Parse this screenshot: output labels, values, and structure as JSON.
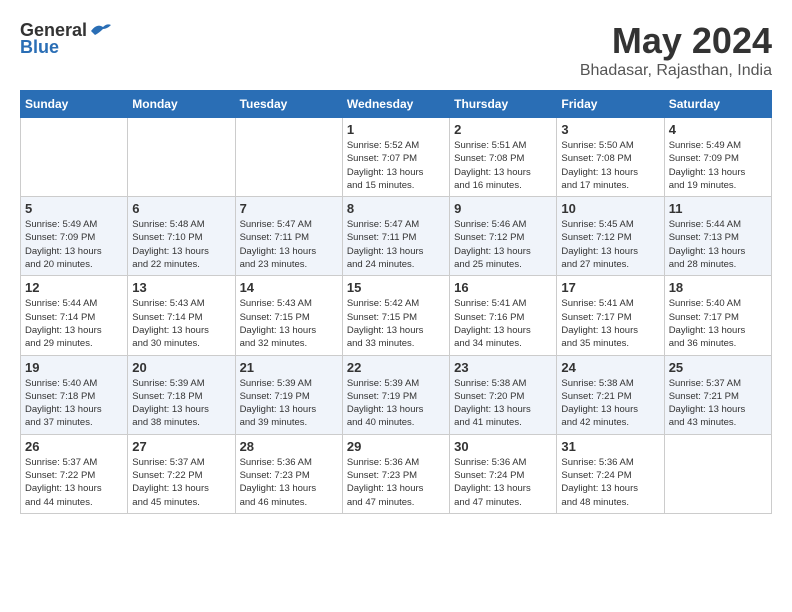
{
  "logo": {
    "general": "General",
    "blue": "Blue"
  },
  "title": "May 2024",
  "location": "Bhadasar, Rajasthan, India",
  "days_header": [
    "Sunday",
    "Monday",
    "Tuesday",
    "Wednesday",
    "Thursday",
    "Friday",
    "Saturday"
  ],
  "weeks": [
    [
      {
        "day": "",
        "info": ""
      },
      {
        "day": "",
        "info": ""
      },
      {
        "day": "",
        "info": ""
      },
      {
        "day": "1",
        "info": "Sunrise: 5:52 AM\nSunset: 7:07 PM\nDaylight: 13 hours\nand 15 minutes."
      },
      {
        "day": "2",
        "info": "Sunrise: 5:51 AM\nSunset: 7:08 PM\nDaylight: 13 hours\nand 16 minutes."
      },
      {
        "day": "3",
        "info": "Sunrise: 5:50 AM\nSunset: 7:08 PM\nDaylight: 13 hours\nand 17 minutes."
      },
      {
        "day": "4",
        "info": "Sunrise: 5:49 AM\nSunset: 7:09 PM\nDaylight: 13 hours\nand 19 minutes."
      }
    ],
    [
      {
        "day": "5",
        "info": "Sunrise: 5:49 AM\nSunset: 7:09 PM\nDaylight: 13 hours\nand 20 minutes."
      },
      {
        "day": "6",
        "info": "Sunrise: 5:48 AM\nSunset: 7:10 PM\nDaylight: 13 hours\nand 22 minutes."
      },
      {
        "day": "7",
        "info": "Sunrise: 5:47 AM\nSunset: 7:11 PM\nDaylight: 13 hours\nand 23 minutes."
      },
      {
        "day": "8",
        "info": "Sunrise: 5:47 AM\nSunset: 7:11 PM\nDaylight: 13 hours\nand 24 minutes."
      },
      {
        "day": "9",
        "info": "Sunrise: 5:46 AM\nSunset: 7:12 PM\nDaylight: 13 hours\nand 25 minutes."
      },
      {
        "day": "10",
        "info": "Sunrise: 5:45 AM\nSunset: 7:12 PM\nDaylight: 13 hours\nand 27 minutes."
      },
      {
        "day": "11",
        "info": "Sunrise: 5:44 AM\nSunset: 7:13 PM\nDaylight: 13 hours\nand 28 minutes."
      }
    ],
    [
      {
        "day": "12",
        "info": "Sunrise: 5:44 AM\nSunset: 7:14 PM\nDaylight: 13 hours\nand 29 minutes."
      },
      {
        "day": "13",
        "info": "Sunrise: 5:43 AM\nSunset: 7:14 PM\nDaylight: 13 hours\nand 30 minutes."
      },
      {
        "day": "14",
        "info": "Sunrise: 5:43 AM\nSunset: 7:15 PM\nDaylight: 13 hours\nand 32 minutes."
      },
      {
        "day": "15",
        "info": "Sunrise: 5:42 AM\nSunset: 7:15 PM\nDaylight: 13 hours\nand 33 minutes."
      },
      {
        "day": "16",
        "info": "Sunrise: 5:41 AM\nSunset: 7:16 PM\nDaylight: 13 hours\nand 34 minutes."
      },
      {
        "day": "17",
        "info": "Sunrise: 5:41 AM\nSunset: 7:17 PM\nDaylight: 13 hours\nand 35 minutes."
      },
      {
        "day": "18",
        "info": "Sunrise: 5:40 AM\nSunset: 7:17 PM\nDaylight: 13 hours\nand 36 minutes."
      }
    ],
    [
      {
        "day": "19",
        "info": "Sunrise: 5:40 AM\nSunset: 7:18 PM\nDaylight: 13 hours\nand 37 minutes."
      },
      {
        "day": "20",
        "info": "Sunrise: 5:39 AM\nSunset: 7:18 PM\nDaylight: 13 hours\nand 38 minutes."
      },
      {
        "day": "21",
        "info": "Sunrise: 5:39 AM\nSunset: 7:19 PM\nDaylight: 13 hours\nand 39 minutes."
      },
      {
        "day": "22",
        "info": "Sunrise: 5:39 AM\nSunset: 7:19 PM\nDaylight: 13 hours\nand 40 minutes."
      },
      {
        "day": "23",
        "info": "Sunrise: 5:38 AM\nSunset: 7:20 PM\nDaylight: 13 hours\nand 41 minutes."
      },
      {
        "day": "24",
        "info": "Sunrise: 5:38 AM\nSunset: 7:21 PM\nDaylight: 13 hours\nand 42 minutes."
      },
      {
        "day": "25",
        "info": "Sunrise: 5:37 AM\nSunset: 7:21 PM\nDaylight: 13 hours\nand 43 minutes."
      }
    ],
    [
      {
        "day": "26",
        "info": "Sunrise: 5:37 AM\nSunset: 7:22 PM\nDaylight: 13 hours\nand 44 minutes."
      },
      {
        "day": "27",
        "info": "Sunrise: 5:37 AM\nSunset: 7:22 PM\nDaylight: 13 hours\nand 45 minutes."
      },
      {
        "day": "28",
        "info": "Sunrise: 5:36 AM\nSunset: 7:23 PM\nDaylight: 13 hours\nand 46 minutes."
      },
      {
        "day": "29",
        "info": "Sunrise: 5:36 AM\nSunset: 7:23 PM\nDaylight: 13 hours\nand 47 minutes."
      },
      {
        "day": "30",
        "info": "Sunrise: 5:36 AM\nSunset: 7:24 PM\nDaylight: 13 hours\nand 47 minutes."
      },
      {
        "day": "31",
        "info": "Sunrise: 5:36 AM\nSunset: 7:24 PM\nDaylight: 13 hours\nand 48 minutes."
      },
      {
        "day": "",
        "info": ""
      }
    ]
  ]
}
